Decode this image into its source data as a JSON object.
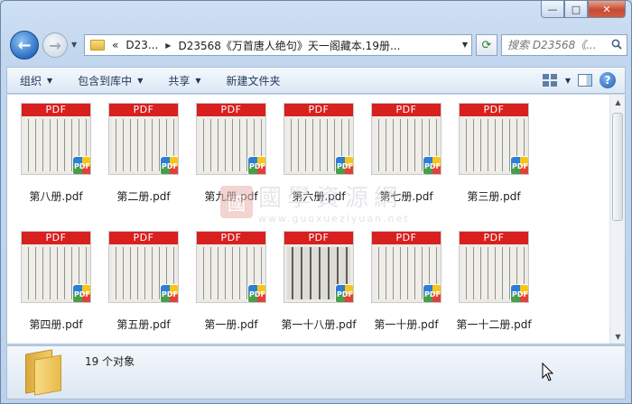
{
  "window": {
    "minimize_label": "—",
    "maximize_label": "□",
    "close_label": "✕"
  },
  "nav": {
    "back_label": "←",
    "forward_label": "→",
    "breadcrumb": {
      "overflow": "«",
      "segments": [
        "D23...",
        "D23568《万首唐人绝句》天一阁藏本.19册..."
      ]
    },
    "search_placeholder": "搜索 D23568《..."
  },
  "toolbar": {
    "organize": "组织",
    "include_in_library": "包含到库中",
    "share": "共享",
    "new_folder": "新建文件夹"
  },
  "files": [
    {
      "name": "第八册.pdf",
      "badge": "PDF"
    },
    {
      "name": "第二册.pdf",
      "badge": "PDF"
    },
    {
      "name": "第九册.pdf",
      "badge": "PDF"
    },
    {
      "name": "第六册.pdf",
      "badge": "PDF"
    },
    {
      "name": "第七册.pdf",
      "badge": "PDF"
    },
    {
      "name": "第三册.pdf",
      "badge": "PDF"
    },
    {
      "name": "第四册.pdf",
      "badge": "PDF"
    },
    {
      "name": "第五册.pdf",
      "badge": "PDF"
    },
    {
      "name": "第一册.pdf",
      "badge": "PDF"
    },
    {
      "name": "第一十八册.pdf",
      "badge": "PDF"
    },
    {
      "name": "第一十册.pdf",
      "badge": "PDF"
    },
    {
      "name": "第一十二册.pdf",
      "badge": "PDF"
    }
  ],
  "watermark": {
    "seal": "國",
    "title": "國學資源網",
    "url": "www.guoxueziyuan.net"
  },
  "status": {
    "object_count": "19 个对象"
  },
  "colors": {
    "pdf_band": "#d8201f",
    "accent": "#1e395b"
  }
}
